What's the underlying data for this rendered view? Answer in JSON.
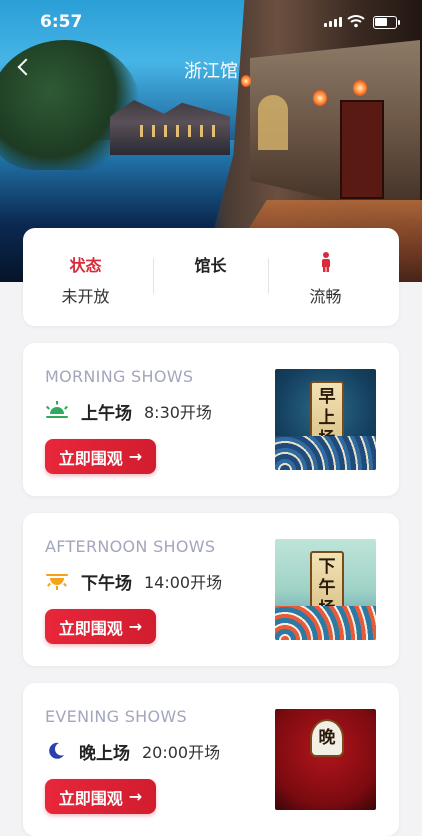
{
  "status_bar": {
    "time": "6:57"
  },
  "nav": {
    "title": "浙江馆"
  },
  "info": {
    "status_label": "状态",
    "status_value": "未开放",
    "curator_label": "馆长",
    "curator_value": "",
    "flow_value": "流畅",
    "accent_color": "#d92b3a"
  },
  "shows": [
    {
      "en": "MORNING SHOWS",
      "zh": "上午场",
      "time": "8:30开场",
      "button": "立即围观",
      "icon": "sunrise-icon",
      "icon_color": "#2eaa5a",
      "poster": [
        "早",
        "上",
        "场"
      ]
    },
    {
      "en": "AFTERNOON SHOWS",
      "zh": "下午场",
      "time": "14:00开场",
      "button": "立即围观",
      "icon": "sunset-icon",
      "icon_color": "#f5a21b",
      "poster": [
        "下",
        "午",
        "场"
      ]
    },
    {
      "en": "EVENING SHOWS",
      "zh": "晚上场",
      "time": "20:00开场",
      "button": "立即围观",
      "icon": "moon-icon",
      "icon_color": "#2a3fb0",
      "poster": [
        "晚"
      ]
    }
  ]
}
